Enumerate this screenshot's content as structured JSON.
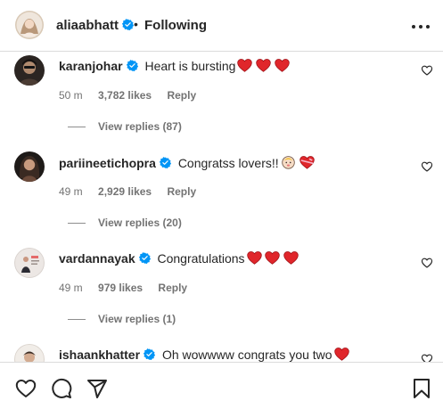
{
  "header": {
    "username": "aliaabhatt",
    "separator": "•",
    "following_label": "Following",
    "more_icon": "more-horizontal-icon"
  },
  "comments": [
    {
      "username": "karanjohar",
      "verified": true,
      "text": "Heart is bursting",
      "emoji": [
        "red-heart",
        "red-heart",
        "red-heart"
      ],
      "time": "50 m",
      "likes": "3,782 likes",
      "reply_label": "Reply",
      "view_replies": "View replies (87)"
    },
    {
      "username": "pariineetichopra",
      "verified": true,
      "text": "Congratss lovers!!",
      "emoji": [
        "baby-face",
        "heart-with-ribbon"
      ],
      "time": "49 m",
      "likes": "2,929 likes",
      "reply_label": "Reply",
      "view_replies": "View replies (20)"
    },
    {
      "username": "vardannayak",
      "verified": true,
      "text": "Congratulations",
      "emoji": [
        "red-heart",
        "red-heart",
        "red-heart"
      ],
      "time": "49 m",
      "likes": "979 likes",
      "reply_label": "Reply",
      "view_replies": "View replies (1)"
    },
    {
      "username": "ishaankhatter",
      "verified": true,
      "text": "Oh wowwww congrats you two",
      "emoji": [
        "red-heart"
      ]
    }
  ],
  "actions": {
    "like_icon": "heart-outline-icon",
    "comment_icon": "comment-bubble-icon",
    "share_icon": "paper-plane-icon",
    "save_icon": "bookmark-icon"
  },
  "colors": {
    "verified_blue": "#0095f6",
    "heart_red": "#e0262b",
    "secondary_text": "#737373",
    "divider": "#dbdbdb"
  }
}
